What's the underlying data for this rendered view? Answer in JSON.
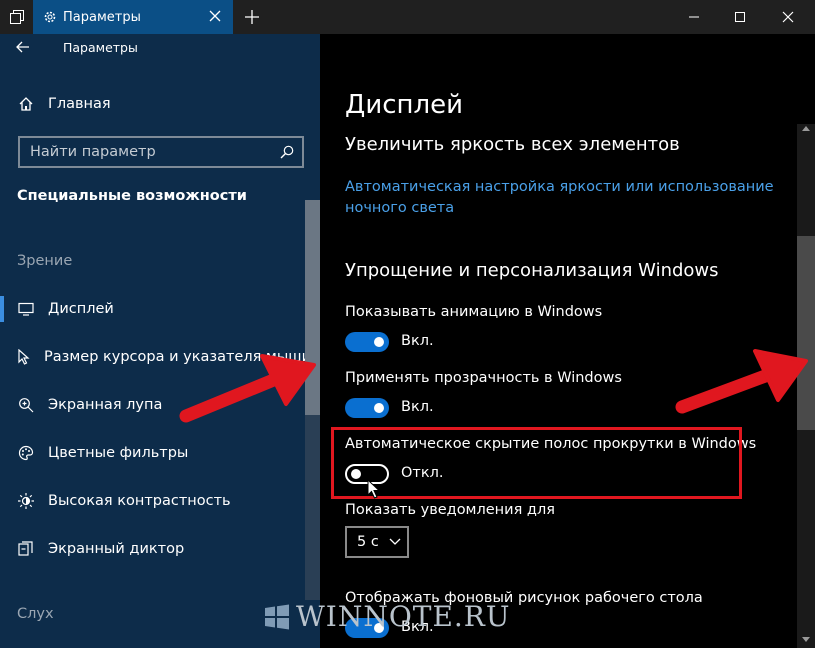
{
  "titlebar": {
    "tab_title": "Параметры",
    "icons": {
      "taskview": "window-stack-icon",
      "tab": "gear-icon",
      "tab_close": "close-icon",
      "new_tab": "plus-icon"
    },
    "controls": {
      "minimize": "minimize-icon",
      "maximize": "maximize-icon",
      "close": "close-icon"
    }
  },
  "sidebar": {
    "back_label": "Параметры",
    "home_label": "Главная",
    "search_placeholder": "Найти параметр",
    "category_title": "Специальные возможности",
    "section_vision": "Зрение",
    "items": [
      {
        "label": "Дисплей",
        "icon": "monitor-icon",
        "active": true
      },
      {
        "label": "Размер курсора и указателя мыши",
        "icon": "cursor-icon"
      },
      {
        "label": "Экранная лупа",
        "icon": "magnifier-icon"
      },
      {
        "label": "Цветные фильтры",
        "icon": "palette-icon"
      },
      {
        "label": "Высокая контрастность",
        "icon": "contrast-icon"
      },
      {
        "label": "Экранный диктор",
        "icon": "narrator-icon"
      }
    ],
    "section_hearing": "Слух"
  },
  "main": {
    "title": "Дисплей",
    "brightness_heading": "Увеличить яркость всех элементов",
    "brightness_link": "Автоматическая настройка яркости или использование ночного света",
    "simplify_heading": "Упрощение и персонализация Windows",
    "settings": [
      {
        "label": "Показывать анимацию в Windows",
        "state": "Вкл.",
        "on": true
      },
      {
        "label": "Применять прозрачность в Windows",
        "state": "Вкл.",
        "on": true
      },
      {
        "label": "Автоматическое скрытие полос прокрутки в Windows",
        "state": "Откл.",
        "on": false
      }
    ],
    "notifications_label": "Показать уведомления для",
    "notifications_value": "5 с",
    "wallpaper_label": "Отображать фоновый рисунок рабочего стола",
    "wallpaper_state": "Вкл."
  },
  "watermark": "WINNOTE.RU",
  "colors": {
    "accent": "#0a6fd0",
    "sidebar_bg": "#0d2c4a",
    "link": "#4aa0e8",
    "highlight": "#e0171f",
    "arrow": "#e0171f"
  }
}
